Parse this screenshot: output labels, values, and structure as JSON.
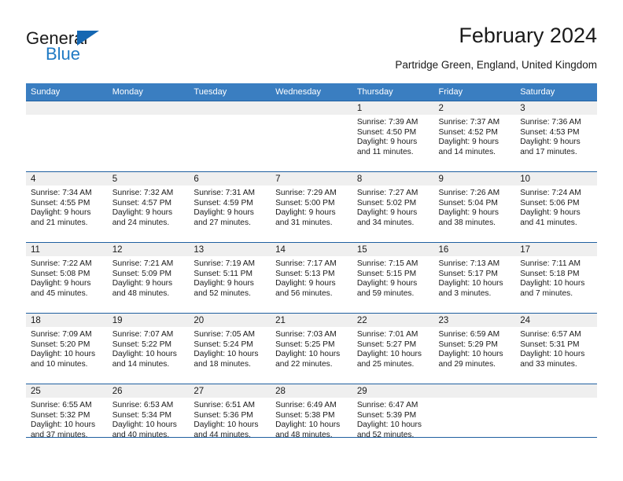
{
  "brand": {
    "name_part1": "General",
    "name_part2": "Blue",
    "triangle_color": "#1567b2",
    "blue_color": "#1f7ac4"
  },
  "header": {
    "title": "February 2024",
    "subtitle": "Partridge Green, England, United Kingdom"
  },
  "theme": {
    "header_row_bg": "#3a7ec1",
    "row_divider": "#1f5fa0",
    "daynum_band_bg": "#efefef",
    "text": "#1a1a1a"
  },
  "calendar": {
    "weekday_headers": [
      "Sunday",
      "Monday",
      "Tuesday",
      "Wednesday",
      "Thursday",
      "Friday",
      "Saturday"
    ],
    "weeks": [
      [
        {
          "day": "",
          "lines": []
        },
        {
          "day": "",
          "lines": []
        },
        {
          "day": "",
          "lines": []
        },
        {
          "day": "",
          "lines": []
        },
        {
          "day": "1",
          "lines": [
            "Sunrise: 7:39 AM",
            "Sunset: 4:50 PM",
            "Daylight: 9 hours",
            "and 11 minutes."
          ]
        },
        {
          "day": "2",
          "lines": [
            "Sunrise: 7:37 AM",
            "Sunset: 4:52 PM",
            "Daylight: 9 hours",
            "and 14 minutes."
          ]
        },
        {
          "day": "3",
          "lines": [
            "Sunrise: 7:36 AM",
            "Sunset: 4:53 PM",
            "Daylight: 9 hours",
            "and 17 minutes."
          ]
        }
      ],
      [
        {
          "day": "4",
          "lines": [
            "Sunrise: 7:34 AM",
            "Sunset: 4:55 PM",
            "Daylight: 9 hours",
            "and 21 minutes."
          ]
        },
        {
          "day": "5",
          "lines": [
            "Sunrise: 7:32 AM",
            "Sunset: 4:57 PM",
            "Daylight: 9 hours",
            "and 24 minutes."
          ]
        },
        {
          "day": "6",
          "lines": [
            "Sunrise: 7:31 AM",
            "Sunset: 4:59 PM",
            "Daylight: 9 hours",
            "and 27 minutes."
          ]
        },
        {
          "day": "7",
          "lines": [
            "Sunrise: 7:29 AM",
            "Sunset: 5:00 PM",
            "Daylight: 9 hours",
            "and 31 minutes."
          ]
        },
        {
          "day": "8",
          "lines": [
            "Sunrise: 7:27 AM",
            "Sunset: 5:02 PM",
            "Daylight: 9 hours",
            "and 34 minutes."
          ]
        },
        {
          "day": "9",
          "lines": [
            "Sunrise: 7:26 AM",
            "Sunset: 5:04 PM",
            "Daylight: 9 hours",
            "and 38 minutes."
          ]
        },
        {
          "day": "10",
          "lines": [
            "Sunrise: 7:24 AM",
            "Sunset: 5:06 PM",
            "Daylight: 9 hours",
            "and 41 minutes."
          ]
        }
      ],
      [
        {
          "day": "11",
          "lines": [
            "Sunrise: 7:22 AM",
            "Sunset: 5:08 PM",
            "Daylight: 9 hours",
            "and 45 minutes."
          ]
        },
        {
          "day": "12",
          "lines": [
            "Sunrise: 7:21 AM",
            "Sunset: 5:09 PM",
            "Daylight: 9 hours",
            "and 48 minutes."
          ]
        },
        {
          "day": "13",
          "lines": [
            "Sunrise: 7:19 AM",
            "Sunset: 5:11 PM",
            "Daylight: 9 hours",
            "and 52 minutes."
          ]
        },
        {
          "day": "14",
          "lines": [
            "Sunrise: 7:17 AM",
            "Sunset: 5:13 PM",
            "Daylight: 9 hours",
            "and 56 minutes."
          ]
        },
        {
          "day": "15",
          "lines": [
            "Sunrise: 7:15 AM",
            "Sunset: 5:15 PM",
            "Daylight: 9 hours",
            "and 59 minutes."
          ]
        },
        {
          "day": "16",
          "lines": [
            "Sunrise: 7:13 AM",
            "Sunset: 5:17 PM",
            "Daylight: 10 hours",
            "and 3 minutes."
          ]
        },
        {
          "day": "17",
          "lines": [
            "Sunrise: 7:11 AM",
            "Sunset: 5:18 PM",
            "Daylight: 10 hours",
            "and 7 minutes."
          ]
        }
      ],
      [
        {
          "day": "18",
          "lines": [
            "Sunrise: 7:09 AM",
            "Sunset: 5:20 PM",
            "Daylight: 10 hours",
            "and 10 minutes."
          ]
        },
        {
          "day": "19",
          "lines": [
            "Sunrise: 7:07 AM",
            "Sunset: 5:22 PM",
            "Daylight: 10 hours",
            "and 14 minutes."
          ]
        },
        {
          "day": "20",
          "lines": [
            "Sunrise: 7:05 AM",
            "Sunset: 5:24 PM",
            "Daylight: 10 hours",
            "and 18 minutes."
          ]
        },
        {
          "day": "21",
          "lines": [
            "Sunrise: 7:03 AM",
            "Sunset: 5:25 PM",
            "Daylight: 10 hours",
            "and 22 minutes."
          ]
        },
        {
          "day": "22",
          "lines": [
            "Sunrise: 7:01 AM",
            "Sunset: 5:27 PM",
            "Daylight: 10 hours",
            "and 25 minutes."
          ]
        },
        {
          "day": "23",
          "lines": [
            "Sunrise: 6:59 AM",
            "Sunset: 5:29 PM",
            "Daylight: 10 hours",
            "and 29 minutes."
          ]
        },
        {
          "day": "24",
          "lines": [
            "Sunrise: 6:57 AM",
            "Sunset: 5:31 PM",
            "Daylight: 10 hours",
            "and 33 minutes."
          ]
        }
      ],
      [
        {
          "day": "25",
          "lines": [
            "Sunrise: 6:55 AM",
            "Sunset: 5:32 PM",
            "Daylight: 10 hours",
            "and 37 minutes."
          ]
        },
        {
          "day": "26",
          "lines": [
            "Sunrise: 6:53 AM",
            "Sunset: 5:34 PM",
            "Daylight: 10 hours",
            "and 40 minutes."
          ]
        },
        {
          "day": "27",
          "lines": [
            "Sunrise: 6:51 AM",
            "Sunset: 5:36 PM",
            "Daylight: 10 hours",
            "and 44 minutes."
          ]
        },
        {
          "day": "28",
          "lines": [
            "Sunrise: 6:49 AM",
            "Sunset: 5:38 PM",
            "Daylight: 10 hours",
            "and 48 minutes."
          ]
        },
        {
          "day": "29",
          "lines": [
            "Sunrise: 6:47 AM",
            "Sunset: 5:39 PM",
            "Daylight: 10 hours",
            "and 52 minutes."
          ]
        },
        {
          "day": "",
          "lines": []
        },
        {
          "day": "",
          "lines": []
        }
      ]
    ]
  }
}
